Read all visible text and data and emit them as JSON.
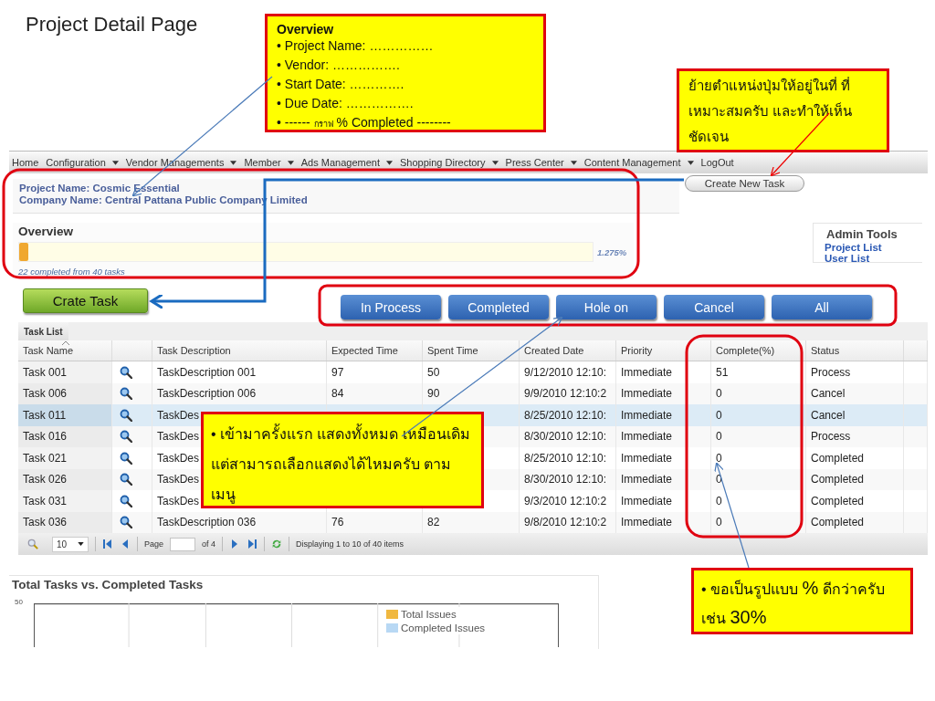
{
  "slide_title": "Project Detail Page",
  "note_overview": {
    "title": "Overview",
    "items": [
      {
        "parts": [
          {
            "text": "• Project Name: ……………",
            "small": false
          }
        ]
      },
      {
        "parts": [
          {
            "text": "• Vendor: …………….",
            "small": false
          }
        ]
      },
      {
        "parts": [
          {
            "text": "• Start Date: ………….",
            "small": false
          }
        ]
      },
      {
        "parts": [
          {
            "text": "• Due Date: …………….",
            "small": false
          }
        ]
      },
      {
        "parts": [
          {
            "text": "•  ------ ",
            "small": false
          },
          {
            "text": "กราฟ",
            "small": true
          },
          {
            "text": " % Completed --------",
            "small": false
          }
        ]
      }
    ]
  },
  "note_button": {
    "text": "ย้ายตำแหน่งปุ่มให้อยู่ในที่ ที่เหมาะสมครับ และทำให้เห็นชัดเจน"
  },
  "note_filter": {
    "text": "• เข้ามาครั้งแรก แสดงทั้งหมด เหมือนเดิม แต่สามารถเลือกแสดงได้ไหมครับ ตามเมนู"
  },
  "note_percent": {
    "parts": [
      {
        "text": "• ขอเป็นรูปแบบ ",
        "large": false
      },
      {
        "text": "%",
        "large": true
      },
      {
        "text": " ดีกว่าครับ เช่น ",
        "large": false
      },
      {
        "text": "30%",
        "large": true
      }
    ]
  },
  "nav": [
    {
      "label": "Home",
      "has_menu": false
    },
    {
      "label": "Configuration",
      "has_menu": true
    },
    {
      "label": "Vendor Managements",
      "has_menu": true
    },
    {
      "label": "Member",
      "has_menu": true
    },
    {
      "label": "Ads Management",
      "has_menu": true
    },
    {
      "label": "Shopping Directory",
      "has_menu": true
    },
    {
      "label": "Press Center",
      "has_menu": true
    },
    {
      "label": "Content Management",
      "has_menu": true
    },
    {
      "label": "LogOut",
      "has_menu": false
    }
  ],
  "project": {
    "name": "Project Name: Cosmic Essential",
    "company": "Company Name: Central Pattana Public Company Limited"
  },
  "create_new_task": "Create New Task",
  "overview": {
    "title": "Overview",
    "level": 0.016,
    "percent": "1.275%",
    "caption": "22 completed from 40 tasks"
  },
  "admin_tools": {
    "title": "Admin Tools",
    "links": [
      "Project List",
      "User List"
    ]
  },
  "create_task": "Crate Task",
  "filters": [
    "In Process",
    "Completed",
    "Hole on",
    "Cancel",
    "All"
  ],
  "tasks": {
    "title": "Task List",
    "columns": [
      {
        "kind": "text",
        "label": "Task Name",
        "sorted": true
      },
      {
        "kind": "icon"
      },
      {
        "kind": "text",
        "label": "Task Description",
        "sorted": false
      },
      {
        "kind": "text",
        "label": "Expected Time",
        "sorted": false
      },
      {
        "kind": "text",
        "label": "Spent Time",
        "sorted": false
      },
      {
        "kind": "text",
        "label": "Created Date",
        "sorted": false
      },
      {
        "kind": "text",
        "label": "Priority",
        "sorted": false
      },
      {
        "kind": "text",
        "label": "Complete(%)",
        "sorted": false
      },
      {
        "kind": "text",
        "label": "Status",
        "sorted": false
      }
    ],
    "rows": [
      {
        "name": "Task 001",
        "description": "TaskDescription 001",
        "expected": "97",
        "spent": "50",
        "created": "9/12/2010 12:10:",
        "priority": "Immediate",
        "complete": "51",
        "status": "Process",
        "selected": false
      },
      {
        "name": "Task 006",
        "description": "TaskDescription 006",
        "expected": "84",
        "spent": "90",
        "created": "9/9/2010 12:10:2",
        "priority": "Immediate",
        "complete": "0",
        "status": "Cancel",
        "selected": false
      },
      {
        "name": "Task 011",
        "description": "TaskDes",
        "created": "8/25/2010 12:10:",
        "priority": "Immediate",
        "complete": "0",
        "status": "Cancel",
        "selected": true
      },
      {
        "name": "Task 016",
        "description": "TaskDes",
        "created": "8/30/2010 12:10:",
        "priority": "Immediate",
        "complete": "0",
        "status": "Process",
        "selected": false
      },
      {
        "name": "Task 021",
        "description": "TaskDes",
        "created": "8/25/2010 12:10:",
        "priority": "Immediate",
        "complete": "0",
        "status": "Completed",
        "selected": false
      },
      {
        "name": "Task 026",
        "description": "TaskDes",
        "created": "8/30/2010 12:10:",
        "priority": "Immediate",
        "complete": "0",
        "status": "Completed",
        "selected": false
      },
      {
        "name": "Task 031",
        "description": "TaskDes",
        "created": "9/3/2010 12:10:2",
        "priority": "Immediate",
        "complete": "0",
        "status": "Completed",
        "selected": false
      },
      {
        "name": "Task 036",
        "description": "TaskDescription 036",
        "expected": "76",
        "spent": "82",
        "created": "9/8/2010 12:10:2",
        "priority": "Immediate",
        "complete": "0",
        "status": "Completed",
        "selected": false
      }
    ]
  },
  "pager": {
    "page_size": "10",
    "page_label": "Page",
    "of_pages": "of 4",
    "summary": "Displaying 1 to 10 of 40 items"
  },
  "chart": {
    "title": "Total Tasks vs. Completed Tasks",
    "top_tick": "50",
    "legend": [
      {
        "label": "Total Issues",
        "color": "#f0b840"
      },
      {
        "label": "Completed Issues",
        "color": "#b8d8f4"
      }
    ]
  }
}
